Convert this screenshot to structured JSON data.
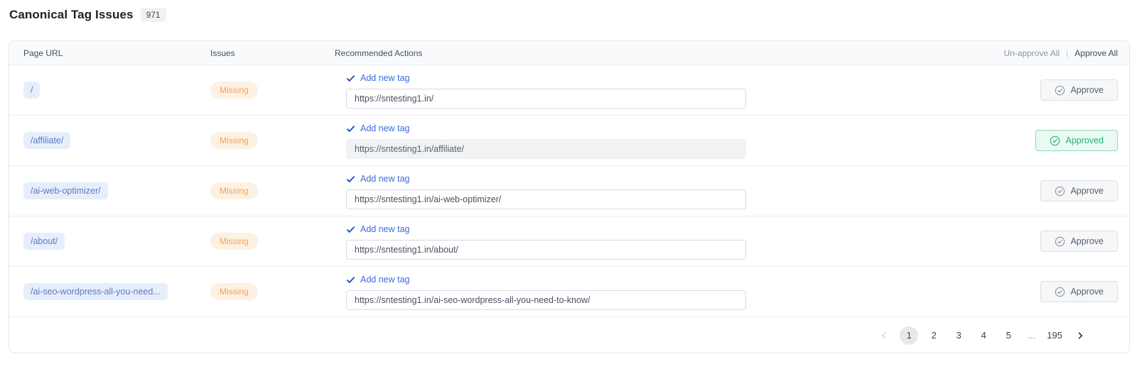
{
  "page": {
    "title": "Canonical Tag Issues",
    "count": "971"
  },
  "table": {
    "columns": {
      "page_url": "Page URL",
      "issues": "Issues",
      "actions": "Recommended Actions"
    },
    "unapprove_all_label": "Un-approve All",
    "approve_all_label": "Approve All",
    "rows": [
      {
        "page_url": "/",
        "issue": "Missing",
        "action_label": "Add new tag",
        "canonical_url": "https://sntesting1.in/",
        "button_label": "Approve"
      },
      {
        "page_url": "/affiliate/",
        "issue": "Missing",
        "action_label": "Add new tag",
        "canonical_url": "https://sntesting1.in/affiliate/",
        "button_label": "Approved"
      },
      {
        "page_url": "/ai-web-optimizer/",
        "issue": "Missing",
        "action_label": "Add new tag",
        "canonical_url": "https://sntesting1.in/ai-web-optimizer/",
        "button_label": "Approve"
      },
      {
        "page_url": "/about/",
        "issue": "Missing",
        "action_label": "Add new tag",
        "canonical_url": "https://sntesting1.in/about/",
        "button_label": "Approve"
      },
      {
        "page_url": "/ai-seo-wordpress-all-you-need...",
        "issue": "Missing",
        "action_label": "Add new tag",
        "canonical_url": "https://sntesting1.in/ai-seo-wordpress-all-you-need-to-know/",
        "button_label": "Approve"
      }
    ]
  },
  "pagination": {
    "pages": [
      "1",
      "2",
      "3",
      "4",
      "5",
      "...",
      "195"
    ],
    "active": "1"
  },
  "colors": {
    "accent_blue": "#3b6ce0",
    "check_blue": "#1d4ed8",
    "missing_bg": "#fdf1e3",
    "missing_text": "#f0a35a",
    "approved_green": "#25b07c",
    "url_chip_bg": "#e7eefb",
    "url_chip_text": "#5b7ac8"
  }
}
